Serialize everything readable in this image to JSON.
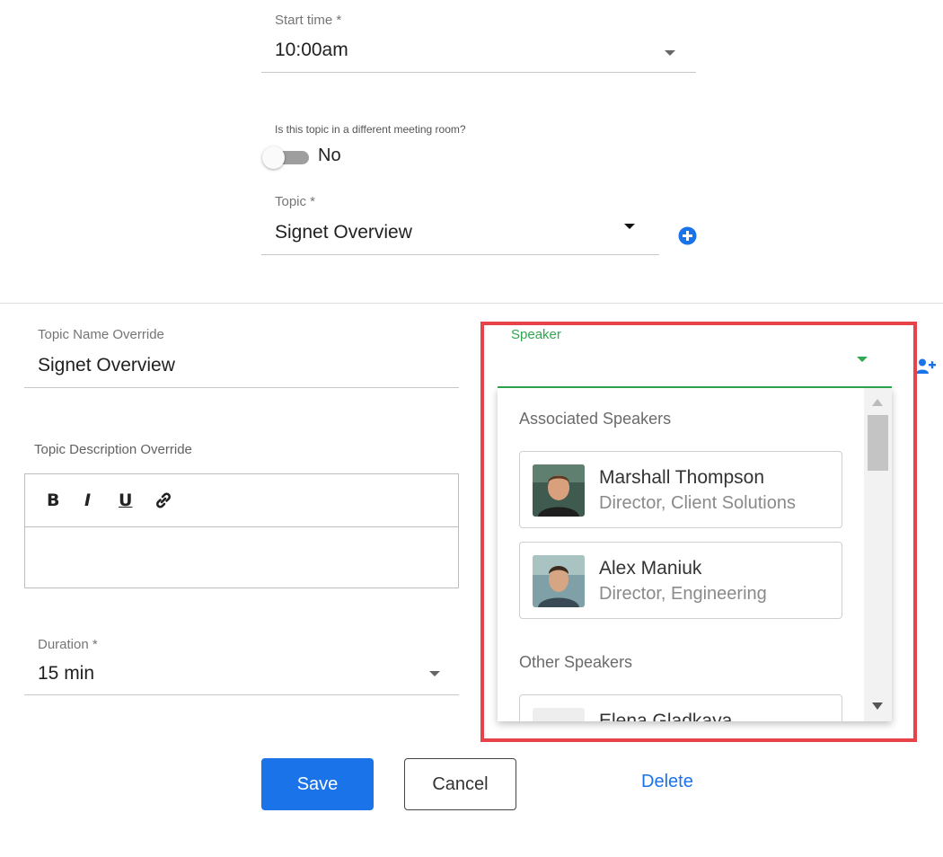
{
  "start_time": {
    "label": "Start time *",
    "value": "10:00am"
  },
  "meeting_room": {
    "question": "Is this topic in a different meeting room?",
    "toggle_value": "No"
  },
  "topic": {
    "label": "Topic *",
    "value": "Signet Overview"
  },
  "topic_name_override": {
    "label": "Topic Name Override",
    "value": "Signet Overview"
  },
  "topic_description_override": {
    "label": "Topic Description Override",
    "toolbar": {
      "bold": "B",
      "italic": "I",
      "underline": "U"
    }
  },
  "duration": {
    "label": "Duration *",
    "value": "15 min"
  },
  "speaker": {
    "label": "Speaker",
    "value": "",
    "associated_heading": "Associated Speakers",
    "associated": [
      {
        "name": "Marshall Thompson",
        "title": "Director, Client Solutions"
      },
      {
        "name": "Alex Maniuk",
        "title": "Director, Engineering"
      }
    ],
    "other_heading": "Other Speakers",
    "other": [
      {
        "name": "Elena Gladkaya",
        "title": ""
      }
    ]
  },
  "actions": {
    "save": "Save",
    "cancel": "Cancel",
    "delete": "Delete"
  },
  "colors": {
    "accent": "#1a73e8",
    "focus_green": "#2fa84f",
    "highlight_red": "#e8424a"
  }
}
